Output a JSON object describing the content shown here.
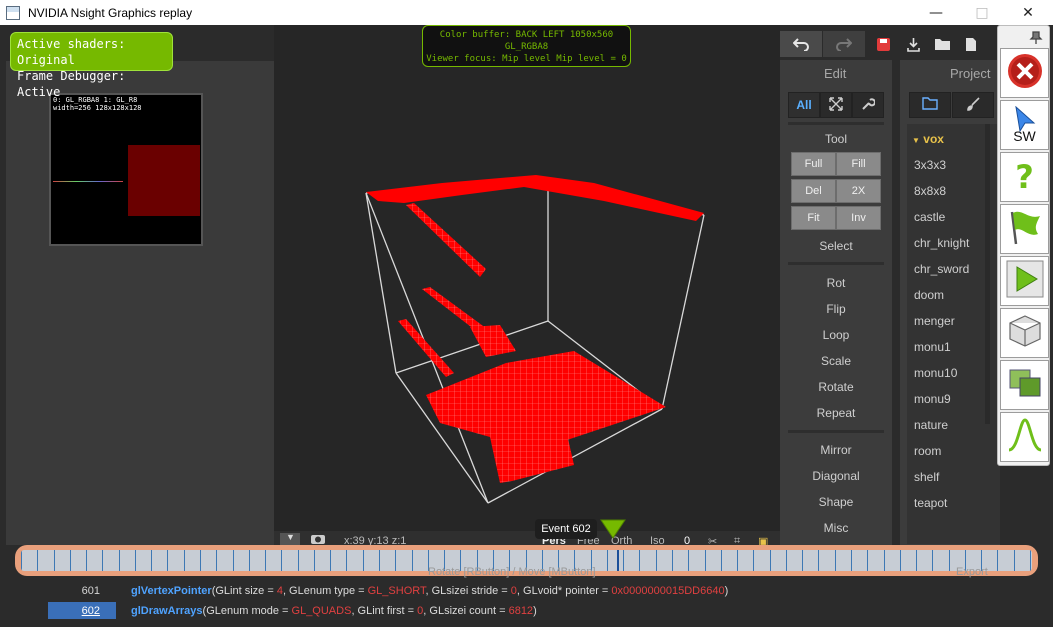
{
  "window": {
    "title": "NVIDIA Nsight Graphics replay",
    "minimize_glyph": "—",
    "maximize_glyph": "□",
    "close_glyph": "✕"
  },
  "overlay": {
    "shader_line1": "Active shaders: Original",
    "shader_line2": "Frame Debugger: Active",
    "color_buffer_line1": "Color buffer: BACK LEFT 1050x560",
    "color_buffer_line2": "GL_RGBA8",
    "color_buffer_line3": "Viewer focus: Mip level Mip level = 0",
    "thumb_line1": "0: GL_RGBA8          1: GL_R8",
    "thumb_line2": "width=256          128x128x128"
  },
  "editor": {
    "edit_heading": "Edit",
    "project_heading": "Project",
    "tab_all": "All",
    "tool_heading": "Tool",
    "grid_buttons": [
      "Full",
      "Fill",
      "Del",
      "2X",
      "Fit",
      "Inv"
    ],
    "select_label": "Select",
    "group1": [
      "Rot",
      "Flip",
      "Loop",
      "Scale",
      "Rotate",
      "Repeat"
    ],
    "group2": [
      "Mirror",
      "Diagonal",
      "Shape",
      "Misc"
    ],
    "project_items": [
      "vox",
      "3x3x3",
      "8x8x8",
      "castle",
      "chr_knight",
      "chr_sword",
      "doom",
      "menger",
      "monu1",
      "monu10",
      "monu9",
      "nature",
      "room",
      "shelf",
      "teapot"
    ],
    "export_label": "Export"
  },
  "launcher": {
    "sw_label": "SW",
    "icons": [
      "close-icon",
      "select-pointer-icon",
      "help-icon",
      "flag-icon",
      "play-icon",
      "cube-icon",
      "layers-icon",
      "curve-icon"
    ]
  },
  "viewport_bar": {
    "coords": "x:39   y:13   z:1",
    "zero": "0",
    "persp": "Pers",
    "free": "Free",
    "orth": "Orth",
    "iso": "Iso",
    "hint": "Rotate [RButton] / Move [MButton]"
  },
  "event": {
    "label": "Event 602",
    "current_index": 602,
    "total_events": 602
  },
  "api": [
    {
      "num": "601",
      "fn": "glVertexPointer",
      "parts": [
        "(GLint size = ",
        "4",
        ", GLenum type = ",
        "GL_SHORT",
        ", GLsizei stride = ",
        "0",
        ", GLvoid* pointer = ",
        "0x0000000015DD6640",
        ")"
      ]
    },
    {
      "num": "602",
      "fn": "glDrawArrays",
      "parts": [
        "(GLenum mode = ",
        "GL_QUADS",
        ", GLint first = ",
        "0",
        ", GLsizei count = ",
        "6812",
        ")"
      ]
    }
  ],
  "colors": {
    "nvidia_green": "#76b900",
    "voxel_red": "#ff0000",
    "link_blue": "#4fa3ff",
    "value_red": "#e04040",
    "timeline_border": "#e9a07c"
  }
}
